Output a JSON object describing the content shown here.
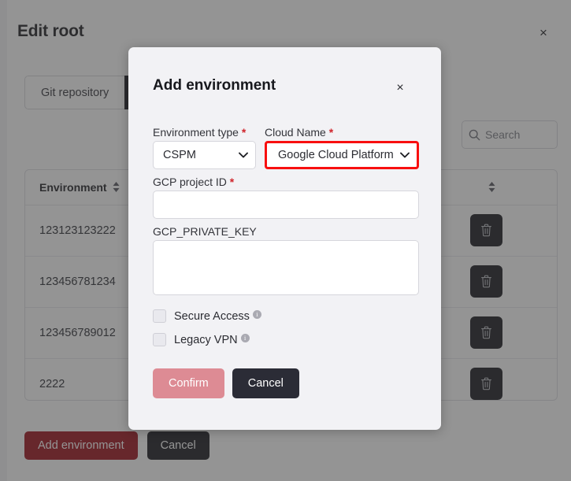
{
  "background": {
    "title": "Edit root",
    "close_label": "×",
    "tabs": [
      {
        "label": "Git repository",
        "active": false
      },
      {
        "label": "",
        "active": true
      }
    ],
    "search": {
      "placeholder": "Search",
      "value": "",
      "icon": "search-icon"
    },
    "table": {
      "columns": [
        "Environment",
        ""
      ],
      "rows": [
        {
          "environment": "123123123222",
          "action_icon": "trash-icon"
        },
        {
          "environment": "123456781234",
          "action_icon": "trash-icon"
        },
        {
          "environment": "123456789012",
          "action_icon": "trash-icon"
        },
        {
          "environment": "2222",
          "action_icon": "trash-icon"
        }
      ]
    },
    "buttons": {
      "add_environment": "Add environment",
      "cancel": "Cancel"
    }
  },
  "modal": {
    "title": "Add environment",
    "close_label": "×",
    "fields": {
      "environment_type": {
        "label": "Environment type",
        "required": "*",
        "value": "CSPM",
        "options": [
          "CSPM"
        ]
      },
      "cloud_name": {
        "label": "Cloud Name",
        "required": "*",
        "value": "Google Cloud Platform",
        "options": [
          "Google Cloud Platform"
        ],
        "highlighted": true
      },
      "gcp_project_id": {
        "label": "GCP project ID",
        "required": "*",
        "value": "",
        "placeholder": ""
      },
      "gcp_private_key": {
        "label": "GCP_PRIVATE_KEY",
        "value": "",
        "placeholder": ""
      },
      "secure_access": {
        "label": "Secure Access",
        "checked": false,
        "info": "i"
      },
      "legacy_vpn": {
        "label": "Legacy VPN",
        "checked": false,
        "info": "i"
      }
    },
    "buttons": {
      "confirm": "Confirm",
      "cancel": "Cancel"
    }
  },
  "colors": {
    "accent_red": "#9b0f1a",
    "highlight_red": "#f80f0f",
    "dark": "#17181d",
    "confirm_muted": "#dd8b94",
    "required_asterisk": "#d0252c"
  }
}
